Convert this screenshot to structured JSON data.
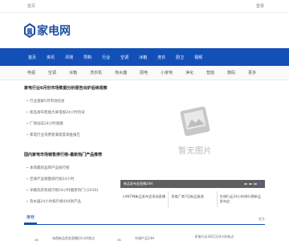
{
  "topbar": {
    "left": "首页",
    "right": "登录"
  },
  "logo": {
    "text": "家电网",
    "color": "#1e4fa3"
  },
  "nav": {
    "items": [
      "首页",
      "资讯",
      "评测",
      "导购",
      "行业",
      "空调",
      "冰箱",
      "洗衣",
      "厨卫",
      "视频"
    ],
    "color": "#1250b8"
  },
  "subnav": {
    "items": [
      "电视",
      "空调",
      "冰箱",
      "洗衣机",
      "热水器",
      "厨电",
      "小家电",
      "净化",
      "智能",
      "数码",
      "更多"
    ]
  },
  "section1": {
    "title": "家电行业6月份市场数据分析报告出炉后续观察",
    "bullets": [
      "行业观察5月市场综述",
      "新品发布智能大屏电视24小时热议",
      "厂商动态24小时观察",
      "家电行业消费者满意度调查报告"
    ]
  },
  "section2": {
    "title": "国内家电市场销售排行榜-最新热门产品推荐",
    "bullets": [
      "本周最新品牌产品排行榜",
      "空调产品销量排行榜24小时",
      "冰箱洗衣机排行榜24小时最新热门-(2016)",
      "热水器24小时排行榜400款产品"
    ]
  },
  "slideshow": {
    "no_image_text": "暂无图片",
    "caption": "新品发布会直播24H",
    "thumbs": [
      "LANTIN新品发布会现场直播",
      "家电厂商7月新品速递",
      "空调行业24小时排行榜新品发布会"
    ]
  },
  "tabs": {
    "active": "推荐",
    "more": "更多"
  },
  "bottom": {
    "item1": "电视新品首发直播24小时热点",
    "item2": "空调产品24H",
    "item3": "· 家电行业365日24小时热点"
  }
}
